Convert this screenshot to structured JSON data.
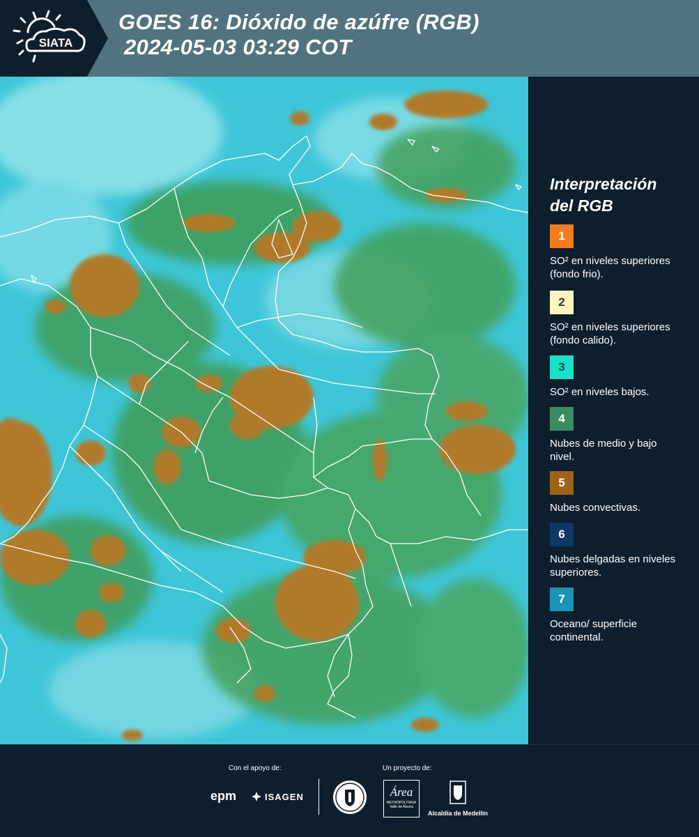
{
  "header": {
    "logo_text": "SIATA",
    "title_line1": "GOES 16: Dióxido de azúfre (RGB)",
    "title_line2": "2024-05-03 03:29 COT",
    "bg_color": "#50737f"
  },
  "map": {
    "background_color": "#3cc4d6",
    "convective_color": "#b07a2c",
    "low_cloud_color": "#3a9a5a",
    "border_color": "#ffffff"
  },
  "legend": {
    "title_line1": "Interpretación",
    "title_line2": "del RGB",
    "items": [
      {
        "number": "1",
        "color": "#f47b20",
        "text_color": "#ffffff",
        "text": "SO² en niveles superiores (fondo frio)."
      },
      {
        "number": "2",
        "color": "#fdf5c0",
        "text_color": "#33333f",
        "text": "SO² en niveles superiores (fondo calido)."
      },
      {
        "number": "3",
        "color": "#19e0c8",
        "text_color": "#1b4b55",
        "text": "SO² en niveles bajos."
      },
      {
        "number": "4",
        "color": "#3a8c63",
        "text_color": "#ffffff",
        "text": "Nubes de medio y bajo nivel."
      },
      {
        "number": "5",
        "color": "#9e6317",
        "text_color": "#ffffff",
        "text": "Nubes convectivas."
      },
      {
        "number": "6",
        "color": "#0f3764",
        "text_color": "#ffffff",
        "text": "Nubes delgadas en niveles superiores."
      },
      {
        "number": "7",
        "color": "#1a93b8",
        "text_color": "#ffffff",
        "text": "Oceano/ superficie continental."
      }
    ]
  },
  "footer": {
    "support_label": "Con el apoyo de:",
    "project_label": "Un proyecto de:",
    "epm_logo_text": "epm",
    "isagen_logo_text": "ISAGEN",
    "area_logo_text": "Área",
    "area_logo_sub1": "METROPOLITANA",
    "area_logo_sub2": "Valle de Aburrá",
    "alcaldia_logo_text": "Alcaldía de Medellín"
  }
}
